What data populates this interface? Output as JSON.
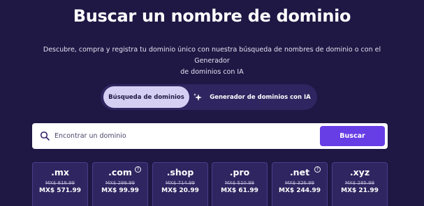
{
  "header": {
    "title": "Buscar un nombre de dominio",
    "subtitle_line1": "Descubre, compra y registra tu dominio único con nuestra búsqueda de nombres de dominio o con el Generador",
    "subtitle_line2": "de dominios con IA"
  },
  "tabs": [
    {
      "label": "Búsqueda de dominios",
      "active": true
    },
    {
      "label": "Generador de dominios con IA",
      "active": false,
      "icon": "sparkle-icon"
    }
  ],
  "search": {
    "placeholder": "Encontrar un dominio",
    "value": "",
    "button_label": "Buscar"
  },
  "tlds": [
    {
      "ext": ".mx",
      "old_price": "MX$ 816.99",
      "price": "MX$ 571.99",
      "help": false
    },
    {
      "ext": ".com",
      "old_price": "MX$ 299.99",
      "price": "MX$ 99.99",
      "help": true
    },
    {
      "ext": ".shop",
      "old_price": "MX$ 714.99",
      "price": "MX$ 20.99",
      "help": false
    },
    {
      "ext": ".pro",
      "old_price": "MX$ 510.99",
      "price": "MX$ 61.99",
      "help": false
    },
    {
      "ext": ".net",
      "old_price": "MX$ 326.99",
      "price": "MX$ 244.99",
      "help": true
    },
    {
      "ext": ".xyz",
      "old_price": "MX$ 285.99",
      "price": "MX$ 21.99",
      "help": false
    }
  ],
  "colors": {
    "background": "#1f1744",
    "accent": "#673de6",
    "card": "#2f2560",
    "active_tab": "#d5d0f3"
  }
}
